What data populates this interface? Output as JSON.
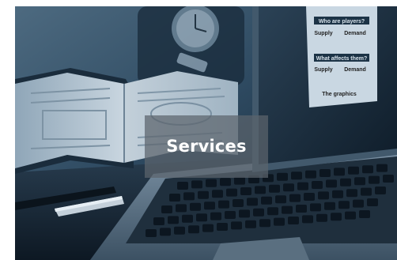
{
  "caption": {
    "title": "Services"
  },
  "screen": {
    "card_heading_1": "Who are players?",
    "card_heading_2": "What affects them?",
    "cell_supply_1": "Supply",
    "cell_demand_1": "Demand",
    "cell_supply_2": "Supply",
    "cell_demand_2": "Demand",
    "footer_label": "The graphics"
  },
  "colors": {
    "photo_tint": "#1f3447",
    "caption_box": "#5c646c",
    "caption_text": "#ffffff"
  }
}
